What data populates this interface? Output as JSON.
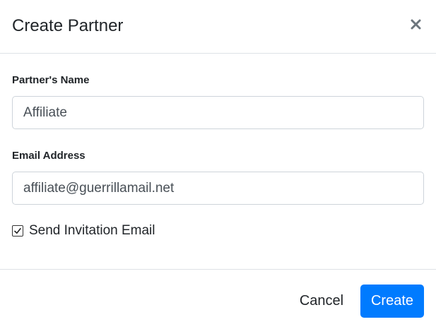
{
  "modal": {
    "title": "Create Partner",
    "close_icon": "close-icon"
  },
  "form": {
    "name_label": "Partner's Name",
    "name_value": "Affiliate",
    "email_label": "Email Address",
    "email_value": "affiliate@guerrillamail.net",
    "invite_label": "Send Invitation Email",
    "invite_checked": true
  },
  "footer": {
    "cancel_label": "Cancel",
    "create_label": "Create"
  },
  "colors": {
    "primary": "#007bff",
    "border": "#dee2e6"
  }
}
